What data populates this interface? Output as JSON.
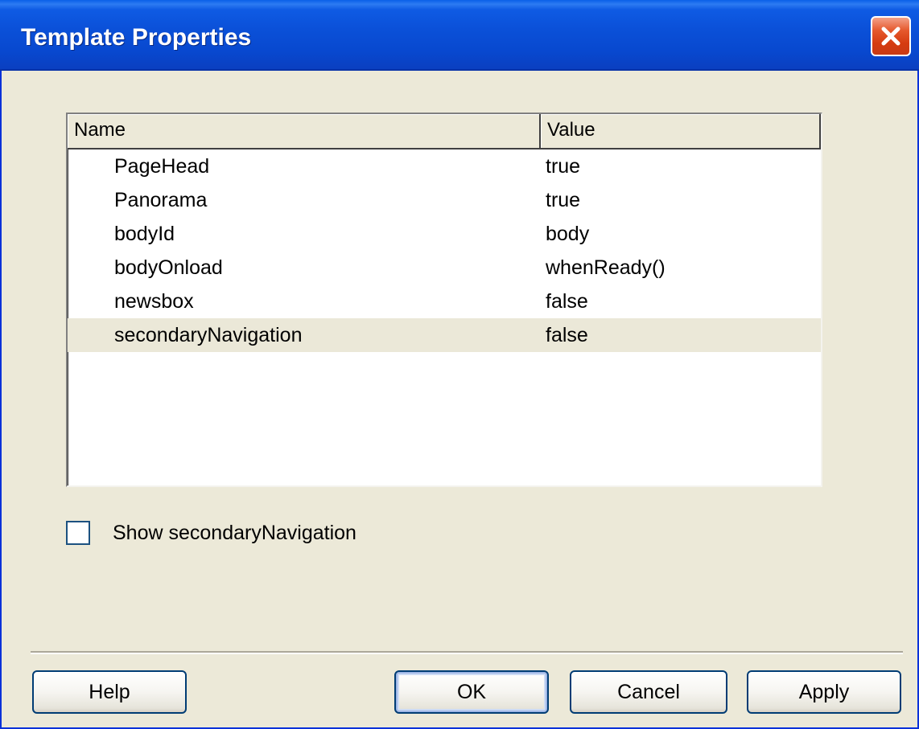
{
  "window": {
    "title": "Template Properties",
    "close_icon": "close-icon"
  },
  "properties_list": {
    "columns": [
      "Name",
      "Value"
    ],
    "rows": [
      {
        "name": "PageHead",
        "value": "true"
      },
      {
        "name": "Panorama",
        "value": "true"
      },
      {
        "name": "bodyId",
        "value": "body"
      },
      {
        "name": "bodyOnload",
        "value": "whenReady()"
      },
      {
        "name": "newsbox",
        "value": "false"
      },
      {
        "name": "secondaryNavigation",
        "value": "false"
      }
    ],
    "selected_row": "secondaryNavigation"
  },
  "checkbox": {
    "label": "Show secondaryNavigation",
    "checked": false
  },
  "buttons": {
    "help": "Help",
    "ok": "OK",
    "cancel": "Cancel",
    "apply": "Apply"
  },
  "colors": {
    "titlebar": "#0b51d9",
    "dialog_bg": "#ece9d8",
    "close_button": "#d53b10",
    "selected_row": "#ebe8d8"
  }
}
